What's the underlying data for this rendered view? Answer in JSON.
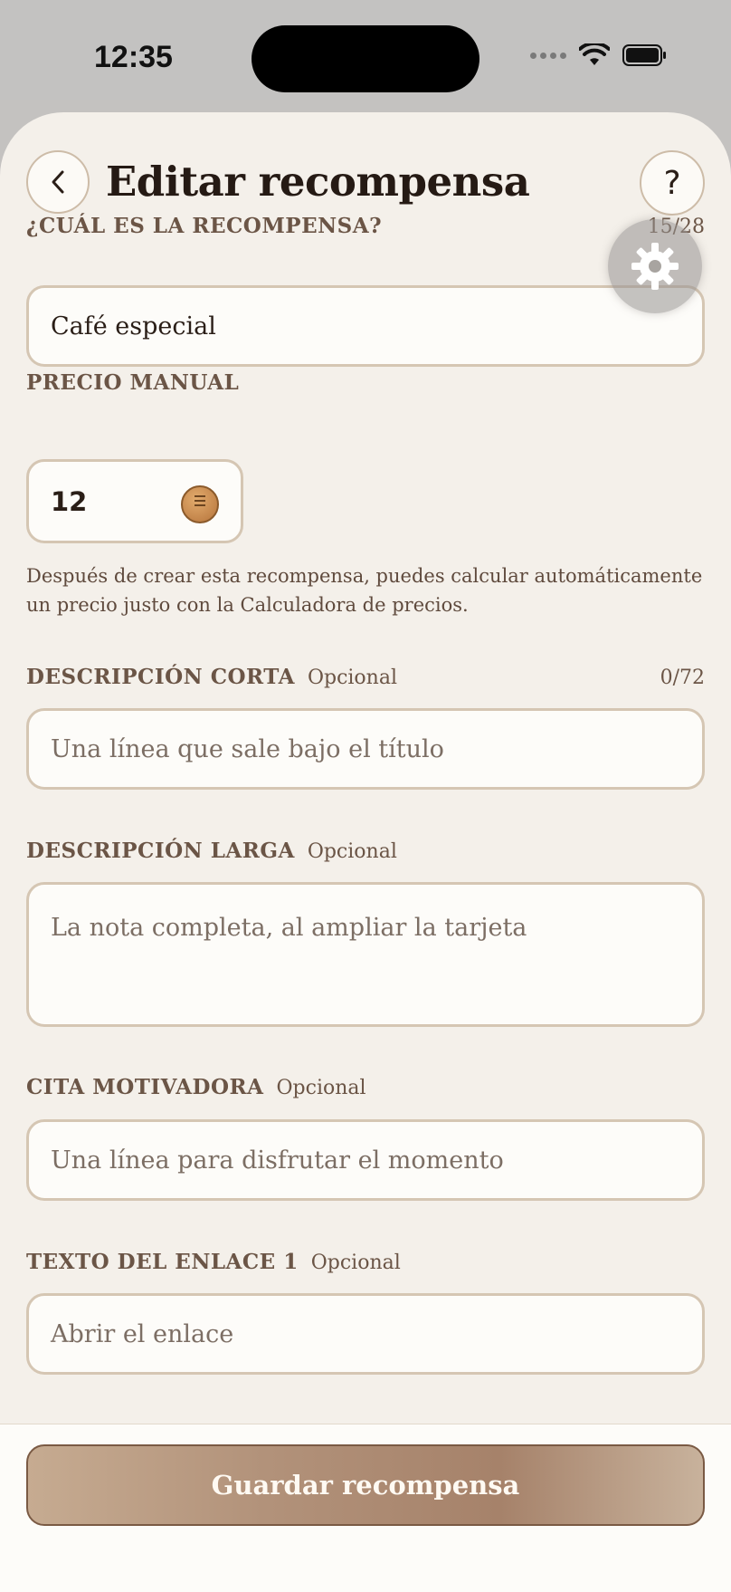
{
  "status_bar": {
    "time": "12:35"
  },
  "header": {
    "title": "Editar recompensa",
    "help_label": "?"
  },
  "reward_field": {
    "label": "¿CUÁL ES LA RECOMPENSA?",
    "counter": "15/28",
    "value": "Café especial"
  },
  "price_field": {
    "label": "PRECIO MANUAL",
    "value": "12",
    "help_text": "Después de crear esta recompensa, puedes calcular automáticamente un precio justo con la Calculadora de precios."
  },
  "short_description": {
    "label": "DESCRIPCIÓN CORTA",
    "optional": "Opcional",
    "counter": "0/72",
    "placeholder": "Una línea que sale bajo el título"
  },
  "long_description": {
    "label": "DESCRIPCIÓN LARGA",
    "optional": "Opcional",
    "placeholder": "La nota completa, al ampliar la tarjeta"
  },
  "quote": {
    "label": "CITA MOTIVADORA",
    "optional": "Opcional",
    "placeholder": "Una línea para disfrutar el momento"
  },
  "link_text": {
    "label": "TEXTO DEL ENLACE 1",
    "optional": "Opcional",
    "placeholder": "Abrir el enlace"
  },
  "footer": {
    "save_label": "Guardar recompensa"
  },
  "icons": {
    "back": "chevron-left-icon",
    "help": "question-icon",
    "settings": "gear-icon",
    "coin": "coin-icon",
    "wifi": "wifi-icon",
    "battery": "battery-icon"
  },
  "colors": {
    "background": "#f4f0ea",
    "input_border": "#d5c6b3",
    "label": "#6b5546",
    "button_gradient_start": "#c6ab91",
    "button_gradient_end": "#c8b29c"
  }
}
